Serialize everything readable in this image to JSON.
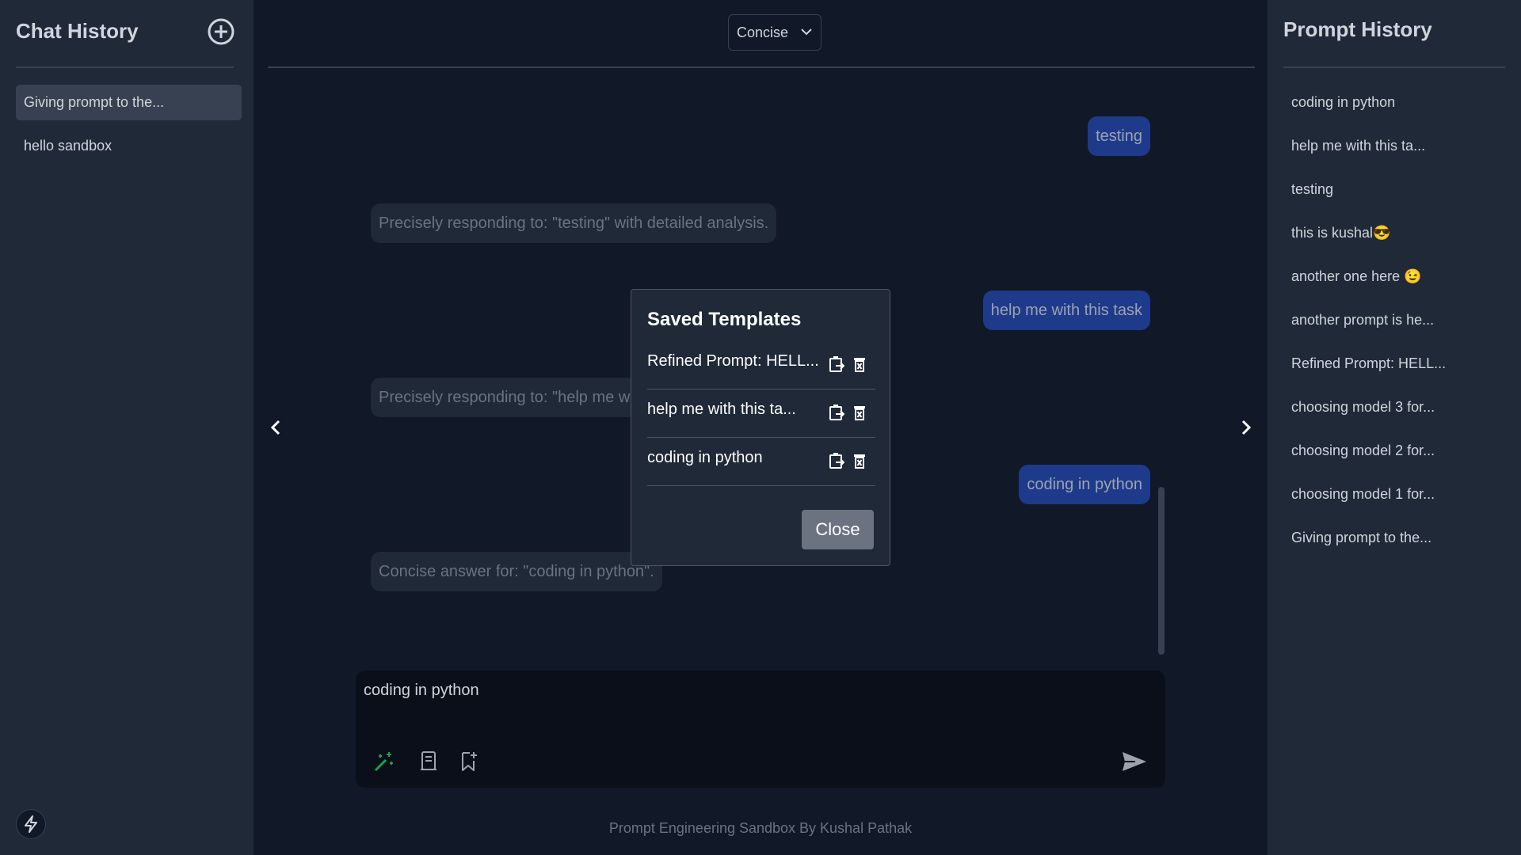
{
  "left_sidebar": {
    "title": "Chat History",
    "chats": [
      {
        "label": "Giving prompt to the...",
        "active": true
      },
      {
        "label": "hello sandbox",
        "active": false
      }
    ]
  },
  "header": {
    "mode_selected": "Concise"
  },
  "messages": [
    {
      "role": "user",
      "text": "testing"
    },
    {
      "role": "assistant",
      "text": "Precisely responding to: \"testing\" with detailed analysis."
    },
    {
      "role": "user",
      "text": "help me with this task"
    },
    {
      "role": "assistant",
      "text": "Precisely responding to: \"help me w"
    },
    {
      "role": "user",
      "text": "coding in python"
    },
    {
      "role": "assistant",
      "text": "Concise answer for: \"coding in python\"."
    }
  ],
  "composer": {
    "value": "coding in python"
  },
  "footer": {
    "text": "Prompt Engineering Sandbox By Kushal Pathak"
  },
  "modal": {
    "title": "Saved Templates",
    "templates": [
      "Refined Prompt: HELL...",
      "help me with this ta...",
      "coding in python"
    ],
    "close_label": "Close"
  },
  "right_sidebar": {
    "title": "Prompt History",
    "prompts": [
      "coding in python",
      "help me with this ta...",
      "testing",
      "this is kushal😎",
      "another one here 😉",
      "another prompt is he...",
      "Refined Prompt: HELL...",
      "choosing model 3 for...",
      "choosing model 2 for...",
      "choosing model 1 for...",
      "Giving prompt to the..."
    ]
  },
  "colors": {
    "background": "#111827",
    "sidebar": "#1f2937",
    "user_bubble": "#1e3a8a",
    "accent_green": "#16a34a"
  }
}
